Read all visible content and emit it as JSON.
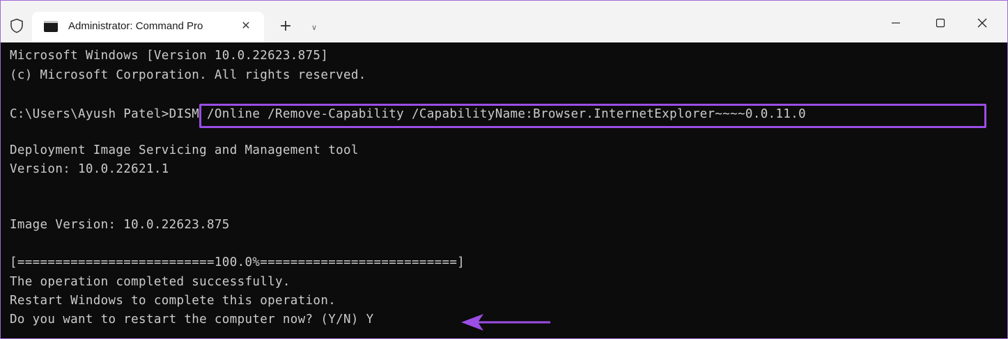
{
  "titlebar": {
    "tab_title": "Administrator: Command Pro",
    "close_tab_glyph": "✕",
    "new_tab_glyph": "+",
    "dropdown_glyph": "∨"
  },
  "console": {
    "lines": [
      "Microsoft Windows [Version 10.0.22623.875]",
      "(c) Microsoft Corporation. All rights reserved.",
      "",
      "C:\\Users\\Ayush Patel>DISM /Online /Remove-Capability /CapabilityName:Browser.InternetExplorer~~~~0.0.11.0",
      "",
      "Deployment Image Servicing and Management tool",
      "Version: 10.0.22621.1",
      "",
      "",
      "Image Version: 10.0.22623.875",
      "",
      "[==========================100.0%==========================]",
      "The operation completed successfully.",
      "Restart Windows to complete this operation.",
      "Do you want to restart the computer now? (Y/N) Y"
    ]
  },
  "colors": {
    "highlight": "#9b4de6",
    "console_bg": "#0c0c0c",
    "console_text": "#cccccc"
  },
  "icons": [
    "shield-icon",
    "terminal-icon",
    "close-icon",
    "plus-icon",
    "chevron-down-icon",
    "minimize-icon",
    "maximize-icon",
    "close-window-icon",
    "arrow-icon"
  ]
}
